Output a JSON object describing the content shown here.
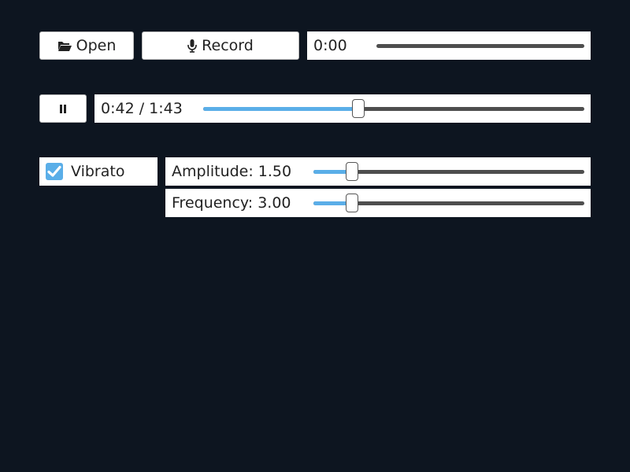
{
  "toolbar": {
    "open_label": "Open",
    "open_icon": "folder-open-icon",
    "record_label": "Record",
    "record_icon": "microphone-icon",
    "record_time": "0:00",
    "record_progress": 0
  },
  "player": {
    "pause_icon": "pause-icon",
    "time_display": "0:42 / 1:43",
    "progress": 0.408
  },
  "vibrato": {
    "label": "Vibrato",
    "checked": true,
    "amplitude": {
      "label": "Amplitude: 1.50",
      "value": 1.5,
      "fraction": 0.141
    },
    "frequency": {
      "label": "Frequency: 3.00",
      "value": 3.0,
      "fraction": 0.141
    }
  },
  "colors": {
    "background": "#0d1520",
    "accent": "#5aaee8",
    "track": "#4e4e4e"
  }
}
